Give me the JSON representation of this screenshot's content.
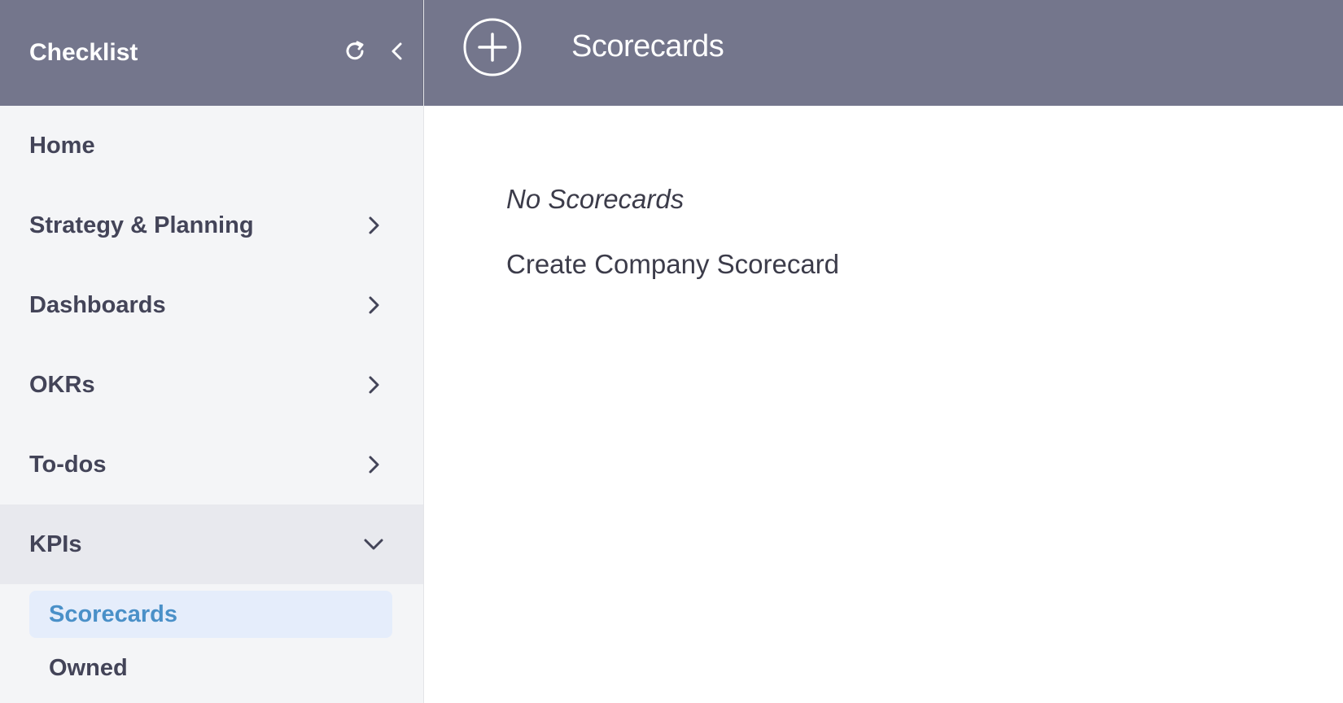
{
  "sidebar": {
    "title": "Checklist",
    "refresh_icon": "refresh-icon",
    "collapse_icon": "chevron-left-icon",
    "items": [
      {
        "label": "Home"
      },
      {
        "label": "Strategy & Planning",
        "icon": "chevron-right-icon"
      },
      {
        "label": "Dashboards",
        "icon": "chevron-right-icon"
      },
      {
        "label": "OKRs",
        "icon": "chevron-right-icon"
      },
      {
        "label": "To-dos",
        "icon": "chevron-right-icon"
      },
      {
        "label": "KPIs",
        "icon": "chevron-down-icon",
        "expanded": true
      }
    ],
    "subitems": [
      {
        "label": "Scorecards",
        "active": true
      },
      {
        "label": "Owned"
      }
    ]
  },
  "header": {
    "title": "Scorecards",
    "add_icon": "plus-circle-icon"
  },
  "main": {
    "empty_text": "No Scorecards",
    "create_link": "Create Company Scorecard"
  },
  "colors": {
    "header_bg": "#74768c",
    "sidebar_bg": "#f4f5f7",
    "expanded_bg": "#e8e9ee",
    "active_bg": "#e5edfb",
    "active_text": "#4a90c8"
  }
}
